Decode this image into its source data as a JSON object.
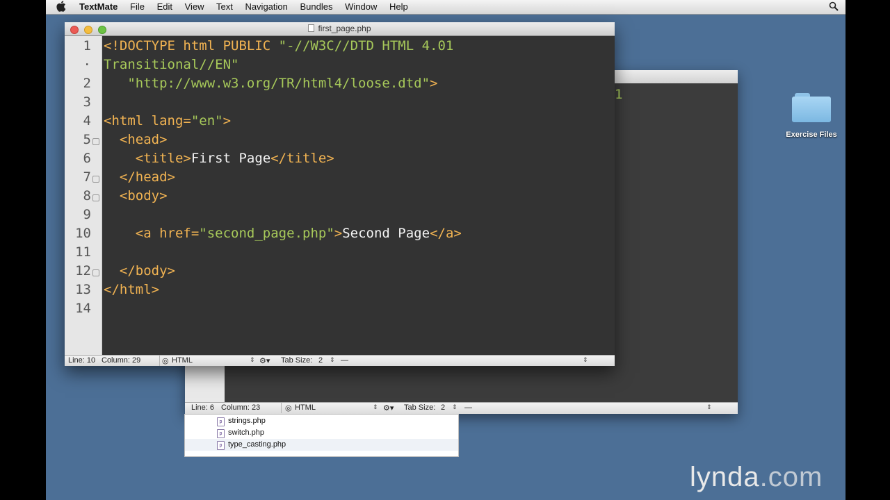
{
  "menubar": {
    "app": "TextMate",
    "items": [
      "File",
      "Edit",
      "View",
      "Text",
      "Navigation",
      "Bundles",
      "Window",
      "Help"
    ]
  },
  "front_window": {
    "title": "first_page.php",
    "lines": [
      {
        "num": "1",
        "html": "<span class='dt'>&lt;!DOCTYPE html PUBLIC </span><span class='st'>\"-//W3C//DTD HTML 4.01</span>"
      },
      {
        "num": "·",
        "html": "<span class='st'>Transitional//EN\"</span>"
      },
      {
        "num": "2",
        "html": "   <span class='st'>\"http://www.w3.org/TR/html4/loose.dtd\"</span><span class='dt'>&gt;</span>"
      },
      {
        "num": "3",
        "html": ""
      },
      {
        "num": "4",
        "html": "<span class='tg'>&lt;html </span><span class='at'>lang=</span><span class='st'>\"en\"</span><span class='tg'>&gt;</span>"
      },
      {
        "num": "5",
        "html": "  <span class='tg'>&lt;head&gt;</span>"
      },
      {
        "num": "6",
        "html": "    <span class='tg'>&lt;title&gt;</span><span class='tx'>First Page</span><span class='tg'>&lt;/title&gt;</span>"
      },
      {
        "num": "7",
        "html": "  <span class='tg'>&lt;/head&gt;</span>"
      },
      {
        "num": "8",
        "html": "  <span class='tg'>&lt;body&gt;</span>"
      },
      {
        "num": "9",
        "html": ""
      },
      {
        "num": "10",
        "html": "    <span class='tg'>&lt;a </span><span class='at'>href=</span><span class='st'>\"second_page.php\"</span><span class='tg'>&gt;</span><span class='tx'>Second Page</span><span class='tg'>&lt;/a&gt;</span>"
      },
      {
        "num": "11",
        "html": ""
      },
      {
        "num": "12",
        "html": "  <span class='tg'>&lt;/body&gt;</span>"
      },
      {
        "num": "13",
        "html": "<span class='tg'>&lt;/html&gt;</span>"
      },
      {
        "num": "14",
        "html": ""
      }
    ],
    "status": {
      "line": "Line: 10",
      "column": "Column: 29",
      "language": "HTML",
      "tab_size": "Tab Size:",
      "tab_value": "2",
      "symbol": "—"
    }
  },
  "back_window": {
    "peek_text": "1",
    "status": {
      "line": "Line: 6",
      "column": "Column: 23",
      "language": "HTML",
      "tab_size": "Tab Size:",
      "tab_value": "2",
      "symbol": "—"
    }
  },
  "file_list": [
    "strings.php",
    "switch.php",
    "type_casting.php"
  ],
  "desktop": {
    "folder_label": "Exercise Files"
  },
  "watermark": {
    "main": "lynda",
    "suffix": ".com"
  }
}
